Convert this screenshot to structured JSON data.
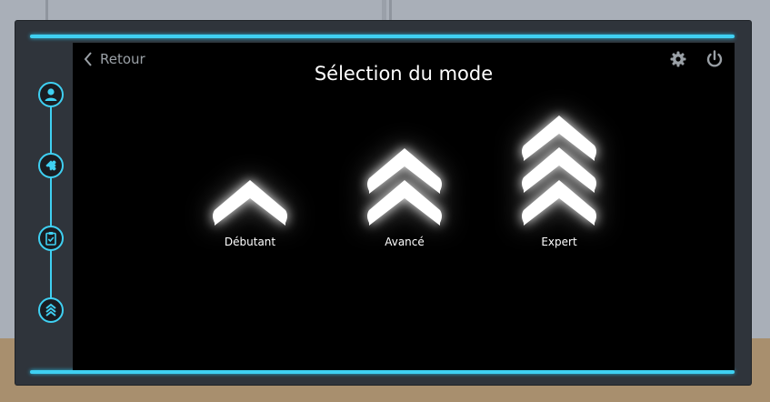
{
  "header": {
    "back_label": "Retour",
    "title": "Sélection du mode"
  },
  "sidebar": {
    "steps": [
      {
        "icon": "user-icon",
        "state": "done"
      },
      {
        "icon": "puzzle-icon",
        "state": "done"
      },
      {
        "icon": "clipboard-check-icon",
        "state": "done"
      },
      {
        "icon": "chevrons-up-icon",
        "state": "current"
      }
    ]
  },
  "modes": [
    {
      "label": "Débutant",
      "level": 1
    },
    {
      "label": "Avancé",
      "level": 2
    },
    {
      "label": "Expert",
      "level": 3
    }
  ],
  "toolbar": {
    "settings_icon": "gear-icon",
    "power_icon": "power-icon"
  },
  "colors": {
    "accent": "#3fd0f2",
    "screen_bg": "#000000",
    "frame": "#2f343b"
  }
}
